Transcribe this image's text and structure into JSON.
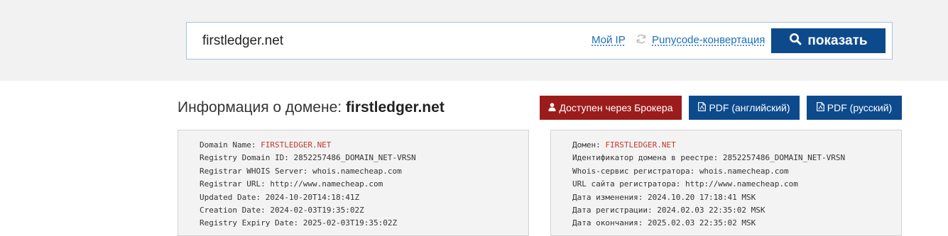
{
  "search": {
    "value": "firstledger.net",
    "my_ip_label": "Мой IP",
    "refresh_icon": "refresh-icon",
    "punycode_label": "Punycode-конвертация",
    "show_label": "показать",
    "show_icon": "search-icon"
  },
  "heading": {
    "prefix": "Информация о домене:",
    "domain": "firstledger.net"
  },
  "actions": {
    "broker_label": "Доступен через Брокера",
    "broker_icon": "user-icon",
    "pdf_en_label": "PDF (английский)",
    "pdf_ru_label": "PDF (русский)",
    "pdf_icon": "pdf-file-icon"
  },
  "colors": {
    "primary": "#0d4a8c",
    "broker": "#9c1c1c",
    "link": "#1a6fb8",
    "highlight": "#c0392b"
  },
  "whois_en": [
    {
      "label": "Domain Name: ",
      "value": "FIRSTLEDGER.NET"
    },
    {
      "label": "Registry Domain ID: ",
      "value": "2852257486_DOMAIN_NET-VRSN"
    },
    {
      "label": "Registrar WHOIS Server: ",
      "value": "whois.namecheap.com"
    },
    {
      "label": "Registrar URL: ",
      "value": "http://www.namecheap.com"
    },
    {
      "label": "Updated Date: ",
      "value": "2024-10-20T14:18:41Z"
    },
    {
      "label": "Creation Date: ",
      "value": "2024-02-03T19:35:02Z"
    },
    {
      "label": "Registry Expiry Date: ",
      "value": "2025-02-03T19:35:02Z"
    }
  ],
  "whois_ru": [
    {
      "label": "Домен: ",
      "value": "FIRSTLEDGER.NET"
    },
    {
      "label": "Идентификатор домена в реестре: ",
      "value": "2852257486_DOMAIN_NET-VRSN"
    },
    {
      "label": "Whois-сервис регистратора: ",
      "value": "whois.namecheap.com"
    },
    {
      "label": "URL сайта регистратора: ",
      "value": "http://www.namecheap.com"
    },
    {
      "label": "Дата изменения: ",
      "value": "2024.10.20 17:18:41 MSK"
    },
    {
      "label": "Дата регистрации: ",
      "value": "2024.02.03 22:35:02 MSK"
    },
    {
      "label": "Дата окончания: ",
      "value": "2025.02.03 22:35:02 MSK"
    }
  ]
}
